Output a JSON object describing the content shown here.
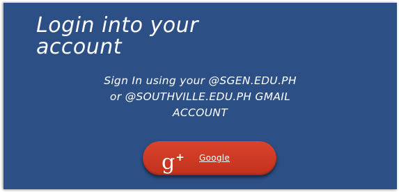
{
  "login": {
    "title_line1": "Login into your",
    "title_line2": "account",
    "subtitle_line1": "Sign In using your @SGEN.EDU.PH",
    "subtitle_line2": "or @SOUTHVILLE.EDU.PH GMAIL",
    "subtitle_line3": "ACCOUNT",
    "google_button": {
      "icon": "google-plus-icon",
      "icon_glyph": "g",
      "icon_plus": "+",
      "label": "Google"
    }
  },
  "colors": {
    "card_background": "#2c4f86",
    "button_red": "#d0391f",
    "text": "#ffffff"
  }
}
